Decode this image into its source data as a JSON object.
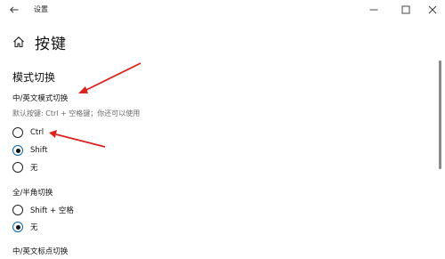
{
  "window": {
    "title": "设置"
  },
  "page": {
    "title": "按键"
  },
  "section": {
    "title": "模式切换"
  },
  "groups": {
    "mode_switch": {
      "title": "中/英文模式切换",
      "hint": "默认按键: Ctrl + 空格键；你还可以使用",
      "options": [
        "Ctrl",
        "Shift",
        "无"
      ],
      "selected": "Shift"
    },
    "width_switch": {
      "title": "全/半角切换",
      "options": [
        "Shift + 空格",
        "无"
      ],
      "selected": "无"
    },
    "punct_switch": {
      "title": "中/英文标点切换"
    }
  },
  "colors": {
    "accent": "#0063b1",
    "annotation_arrow": "#d9231f",
    "hint_text": "#6b6b6b"
  }
}
